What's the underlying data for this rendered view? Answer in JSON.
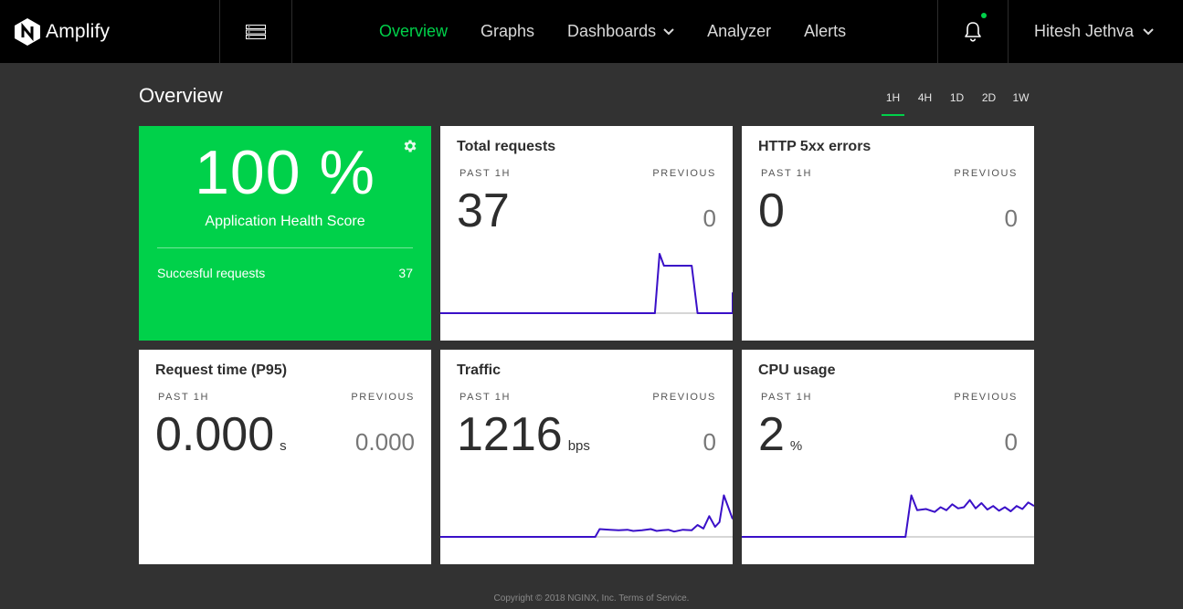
{
  "brand": {
    "name": "Amplify"
  },
  "nav": {
    "items": [
      {
        "label": "Overview"
      },
      {
        "label": "Graphs"
      },
      {
        "label": "Dashboards"
      },
      {
        "label": "Analyzer"
      },
      {
        "label": "Alerts"
      }
    ],
    "active": "Overview",
    "user": "Hitesh Jethva",
    "notification_dot_color": "#00d14a"
  },
  "page": {
    "title": "Overview",
    "ranges": [
      "1H",
      "4H",
      "1D",
      "2D",
      "1W"
    ],
    "active_range": "1H"
  },
  "health": {
    "score": "100 %",
    "label": "Application Health Score",
    "success_label": "Succesful requests",
    "success_value": "37",
    "color": "#00d14a"
  },
  "cards": {
    "total_requests": {
      "title": "Total requests",
      "past_label": "PAST 1H",
      "prev_label": "PREVIOUS",
      "value": "37",
      "unit": "",
      "previous": "0"
    },
    "http_5xx": {
      "title": "HTTP 5xx errors",
      "past_label": "PAST 1H",
      "prev_label": "PREVIOUS",
      "value": "0",
      "unit": "",
      "previous": "0"
    },
    "request_time": {
      "title": "Request time (P95)",
      "past_label": "PAST 1H",
      "prev_label": "PREVIOUS",
      "value": "0.000",
      "unit": "s",
      "previous": "0.000"
    },
    "traffic": {
      "title": "Traffic",
      "past_label": "PAST 1H",
      "prev_label": "PREVIOUS",
      "value": "1216",
      "unit": "bps",
      "previous": "0"
    },
    "cpu": {
      "title": "CPU usage",
      "past_label": "PAST 1H",
      "prev_label": "PREVIOUS",
      "value": "2",
      "unit": "%",
      "previous": "0"
    }
  },
  "sparklines": {
    "line_color": "#3a10c8",
    "baseline_color": "#3c5a9a",
    "total_requests": [
      0,
      0,
      0,
      0,
      0,
      0,
      0,
      0,
      0,
      0,
      0,
      0,
      0,
      0,
      0,
      0,
      0,
      0,
      0,
      0,
      0,
      0,
      0,
      0,
      0,
      0,
      0,
      0,
      0,
      0,
      0,
      0,
      0,
      0,
      0,
      0,
      0,
      0,
      0,
      0,
      0,
      0,
      0,
      0,
      0,
      0,
      0,
      0,
      0,
      0,
      0,
      0,
      0,
      0,
      0,
      0,
      0,
      0,
      0,
      0,
      0,
      0,
      0,
      0,
      0,
      0,
      0,
      0,
      0,
      0,
      0,
      0,
      0,
      0,
      0,
      0,
      0,
      0,
      0,
      0,
      0,
      0,
      0,
      0,
      0,
      0,
      0,
      0,
      0,
      0,
      0,
      0,
      0,
      0,
      0,
      0,
      0,
      0,
      0,
      0,
      0,
      0,
      0,
      0,
      0,
      0,
      0,
      0,
      0,
      0,
      0,
      0,
      0,
      0,
      0,
      0,
      0,
      0,
      0,
      0,
      0,
      0,
      0,
      0,
      0,
      0,
      0,
      0,
      0,
      0,
      0,
      0,
      0,
      0,
      0,
      0,
      0,
      0,
      0,
      0,
      0,
      0,
      0,
      0,
      0,
      0,
      0,
      0,
      0,
      0,
      0,
      0,
      0,
      0,
      0,
      0,
      0,
      0,
      0,
      0,
      0,
      0,
      0,
      0,
      0,
      0,
      0,
      0,
      0,
      0,
      0,
      0,
      0,
      0,
      0,
      0,
      0,
      0,
      0,
      0,
      0,
      0,
      0,
      0,
      0,
      0,
      0,
      0,
      0,
      0,
      0,
      0,
      0,
      0,
      0,
      0,
      0,
      0,
      0,
      0,
      0,
      0,
      0,
      0,
      0,
      0,
      0,
      0,
      0,
      0,
      0,
      0,
      0,
      0,
      0,
      0,
      0,
      0,
      0,
      0,
      0,
      0,
      0,
      0,
      0,
      0,
      0,
      0,
      0,
      0,
      0,
      0,
      0,
      0,
      0,
      0,
      0,
      0,
      0,
      0,
      0,
      0,
      0,
      0,
      0,
      0,
      0,
      0,
      0,
      0,
      0,
      0,
      0,
      0,
      0,
      0,
      0,
      0,
      0,
      0,
      0,
      0,
      0,
      0,
      0,
      0,
      0,
      0,
      0,
      0,
      0,
      0,
      0,
      0,
      0,
      0,
      0,
      0,
      0,
      0,
      0,
      0,
      0,
      0,
      0,
      0,
      0,
      0,
      0,
      0,
      0,
      0,
      0,
      0,
      0,
      0,
      0,
      0,
      0,
      0,
      0,
      0,
      0,
      0,
      0,
      0,
      0,
      0,
      0,
      0,
      0,
      0
    ],
    "total_requests_points": [
      [
        0,
        0
      ],
      [
        0.734,
        0
      ],
      [
        0.75,
        1
      ],
      [
        0.765,
        0.8
      ],
      [
        0.86,
        0.8
      ],
      [
        0.88,
        0
      ],
      [
        1.0,
        0
      ],
      [
        1.0,
        0.35
      ]
    ],
    "traffic_points": [
      [
        0,
        0
      ],
      [
        0.53,
        0
      ],
      [
        0.545,
        0.13
      ],
      [
        0.58,
        0.12
      ],
      [
        0.61,
        0.11
      ],
      [
        0.64,
        0.12
      ],
      [
        0.66,
        0.1
      ],
      [
        0.69,
        0.11
      ],
      [
        0.72,
        0.13
      ],
      [
        0.74,
        0.1
      ],
      [
        0.76,
        0.11
      ],
      [
        0.78,
        0.12
      ],
      [
        0.8,
        0.09
      ],
      [
        0.83,
        0.12
      ],
      [
        0.86,
        0.11
      ],
      [
        0.88,
        0.2
      ],
      [
        0.9,
        0.14
      ],
      [
        0.92,
        0.35
      ],
      [
        0.94,
        0.17
      ],
      [
        0.955,
        0.25
      ],
      [
        0.97,
        0.7
      ],
      [
        0.985,
        0.5
      ],
      [
        1.0,
        0.3
      ]
    ],
    "cpu_points": [
      [
        0,
        0
      ],
      [
        0.56,
        0
      ],
      [
        0.58,
        0.7
      ],
      [
        0.6,
        0.45
      ],
      [
        0.63,
        0.47
      ],
      [
        0.66,
        0.42
      ],
      [
        0.68,
        0.5
      ],
      [
        0.7,
        0.45
      ],
      [
        0.72,
        0.55
      ],
      [
        0.74,
        0.48
      ],
      [
        0.76,
        0.5
      ],
      [
        0.78,
        0.62
      ],
      [
        0.8,
        0.48
      ],
      [
        0.82,
        0.57
      ],
      [
        0.84,
        0.46
      ],
      [
        0.86,
        0.52
      ],
      [
        0.88,
        0.44
      ],
      [
        0.9,
        0.5
      ],
      [
        0.92,
        0.43
      ],
      [
        0.94,
        0.52
      ],
      [
        0.96,
        0.47
      ],
      [
        0.98,
        0.58
      ],
      [
        1.0,
        0.52
      ]
    ]
  },
  "footer": {
    "text": "Copyright © 2018 NGINX, Inc. Terms of Service."
  }
}
